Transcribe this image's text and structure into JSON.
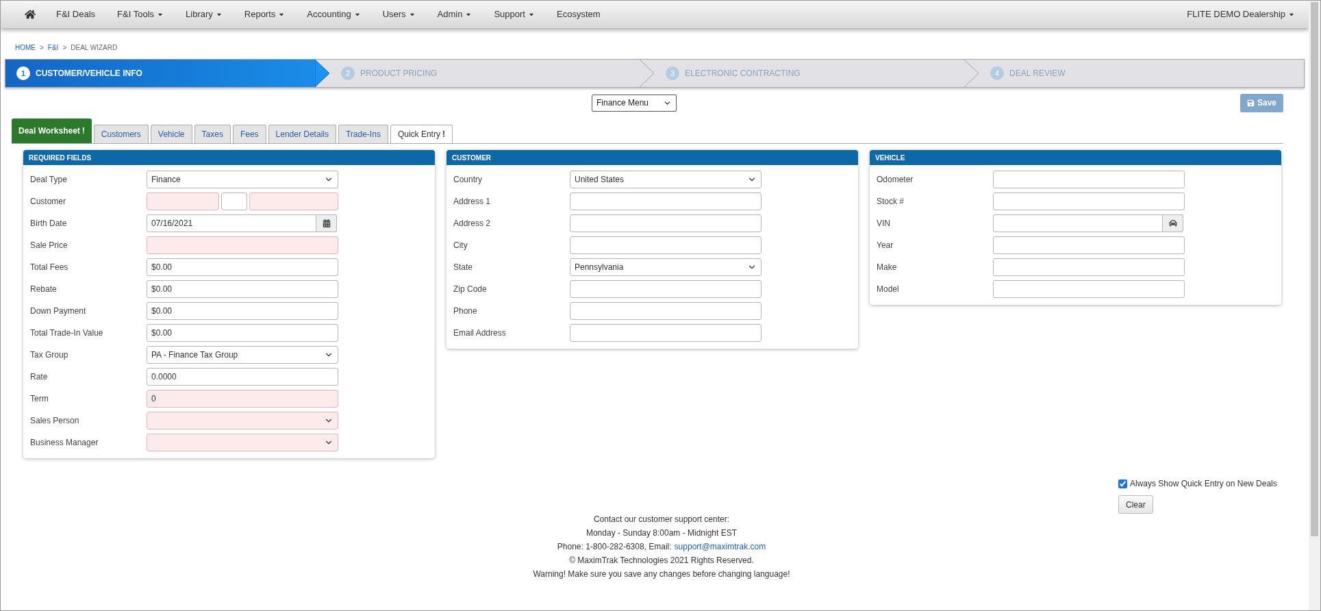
{
  "navbar": {
    "items": [
      {
        "label": "F&I Deals",
        "dropdown": false
      },
      {
        "label": "F&I Tools",
        "dropdown": true
      },
      {
        "label": "Library",
        "dropdown": true
      },
      {
        "label": "Reports",
        "dropdown": true
      },
      {
        "label": "Accounting",
        "dropdown": true
      },
      {
        "label": "Users",
        "dropdown": true
      },
      {
        "label": "Admin",
        "dropdown": true
      },
      {
        "label": "Support",
        "dropdown": true
      },
      {
        "label": "Ecosystem",
        "dropdown": false
      }
    ],
    "dealership": {
      "label": "FLITE DEMO Dealership",
      "dropdown": true
    }
  },
  "breadcrumb": [
    {
      "label": "HOME",
      "link": true,
      "separator": ">"
    },
    {
      "label": "F&I",
      "link": true,
      "separator": ">"
    },
    {
      "label": "DEAL WIZARD",
      "link": false
    }
  ],
  "wizard_steps": [
    {
      "number": "1",
      "label": "CUSTOMER/VEHICLE INFO",
      "selected": true
    },
    {
      "number": "2",
      "label": "PRODUCT PRICING",
      "selected": false
    },
    {
      "number": "3",
      "label": "ELECTRONIC CONTRACTING",
      "selected": false
    },
    {
      "number": "4",
      "label": "DEAL REVIEW",
      "selected": false
    }
  ],
  "menu_select": {
    "value": "Finance Menu"
  },
  "save_button": {
    "label": "Save",
    "disabled": true
  },
  "tabs": [
    {
      "label": "Deal Worksheet",
      "alert": "!",
      "selected": true,
      "kind": "normal"
    },
    {
      "label": "Customers",
      "selected": false,
      "kind": "normal"
    },
    {
      "label": "Vehicle",
      "selected": false,
      "kind": "normal"
    },
    {
      "label": "Taxes",
      "selected": false,
      "kind": "normal"
    },
    {
      "label": "Fees",
      "selected": false,
      "kind": "normal"
    },
    {
      "label": "Lender Details",
      "selected": false,
      "kind": "normal"
    },
    {
      "label": "Trade-Ins",
      "selected": false,
      "kind": "normal"
    },
    {
      "label": "Quick Entry",
      "alert": "!",
      "selected": false,
      "kind": "plain"
    }
  ],
  "panels": [
    {
      "title": "REQUIRED FIELDS",
      "fields": [
        {
          "label": "Deal Type",
          "kind": "select",
          "value": "Finance",
          "required": false
        },
        {
          "label": "Customer",
          "kind": "name",
          "parts": [
            {
              "required": true
            },
            {
              "required": false
            },
            {
              "required": true
            }
          ]
        },
        {
          "label": "Birth Date",
          "kind": "date",
          "value": "07/16/2021",
          "required": false
        },
        {
          "label": "Sale Price",
          "kind": "text",
          "required": true
        },
        {
          "label": "Total Fees",
          "kind": "text",
          "value": "$0.00",
          "required": false
        },
        {
          "label": "Rebate",
          "kind": "text",
          "value": "$0.00",
          "required": false
        },
        {
          "label": "Down Payment",
          "kind": "text",
          "value": "$0.00",
          "required": false
        },
        {
          "label": "Total Trade-In Value",
          "kind": "text",
          "value": "$0.00",
          "required": false
        },
        {
          "label": "Tax Group",
          "kind": "select",
          "value": "PA - Finance Tax Group",
          "required": false
        },
        {
          "label": "Rate",
          "kind": "text",
          "value": "0.0000",
          "required": false
        },
        {
          "label": "Term",
          "kind": "text",
          "value": "0",
          "required": true
        },
        {
          "label": "Sales Person",
          "kind": "select",
          "required": true
        },
        {
          "label": "Business Manager",
          "kind": "select",
          "required": true
        }
      ]
    },
    {
      "title": "CUSTOMER",
      "fields": [
        {
          "label": "Country",
          "kind": "select",
          "value": "United States",
          "required": false
        },
        {
          "label": "Address 1",
          "kind": "text",
          "required": false
        },
        {
          "label": "Address 2",
          "kind": "text",
          "required": false
        },
        {
          "label": "City",
          "kind": "text",
          "required": false
        },
        {
          "label": "State",
          "kind": "select",
          "value": "Pennsylvania",
          "required": false
        },
        {
          "label": "Zip Code",
          "kind": "text",
          "required": false
        },
        {
          "label": "Phone",
          "kind": "text",
          "required": false
        },
        {
          "label": "Email Address",
          "kind": "text",
          "required": false
        }
      ]
    },
    {
      "title": "VEHICLE",
      "fields": [
        {
          "label": "Odometer",
          "kind": "text",
          "required": false
        },
        {
          "label": "Stock #",
          "kind": "text",
          "required": false
        },
        {
          "label": "VIN",
          "kind": "vin",
          "required": false
        },
        {
          "label": "Year",
          "kind": "text",
          "required": false
        },
        {
          "label": "Make",
          "kind": "text",
          "required": false
        },
        {
          "label": "Model",
          "kind": "text",
          "required": false
        }
      ]
    }
  ],
  "quick_entry": {
    "checkbox_label": "Always Show Quick Entry on New Deals",
    "checked": true,
    "clear_button": "Clear"
  },
  "footer": {
    "lines": [
      "Contact our customer support center:",
      "Monday - Sunday 8:00am - Midnight EST"
    ],
    "contact_prefix": "Phone: 1-800-282-6308, Email:",
    "email": "support@maximtrak.com",
    "more_lines": [
      "© MaximTrak Technologies 2021 Rights Reserved.",
      "Warning! Make sure you save any changes before changing language!"
    ]
  }
}
